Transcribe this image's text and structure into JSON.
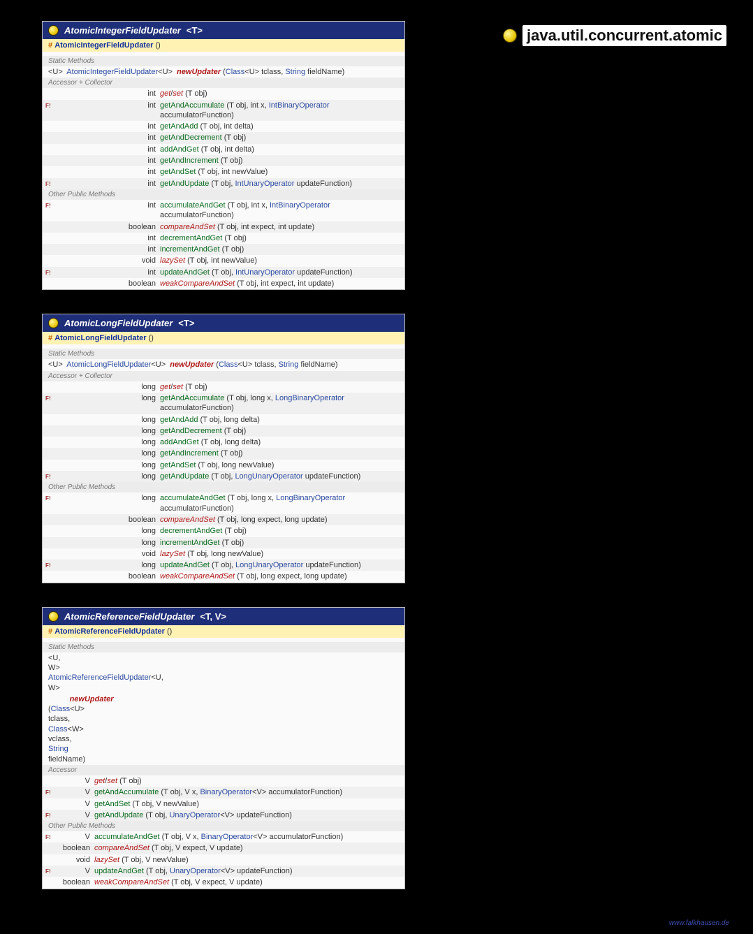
{
  "package_title": "java.util.concurrent.atomic",
  "footer": "www.falkhausen.de",
  "classes": [
    {
      "id": "aifu",
      "name": "AtomicIntegerFieldUpdater",
      "generic": "<T>",
      "constructor": "AtomicIntegerFieldUpdater",
      "static_line_html": "&lt;U&gt;&nbsp; <span class='t-type'>AtomicIntegerFieldUpdater</span>&lt;U&gt;&nbsp; <span class='m-red' style='font-weight:700'>newUpdater</span> (<span class='t-type'>Class</span>&lt;U&gt; tclass, <span class='t-type'>String</span> fieldName)",
      "groups": [
        {
          "header": "Static Methods",
          "static": true
        },
        {
          "header": "Accessor + Collector",
          "rows": [
            {
              "flag": "",
              "ret": "int",
              "sig": "<span class='m-red'>get</span>/<span class='m-red'>set</span> (T obj)"
            },
            {
              "flag": "F !",
              "ret": "int",
              "sig": "<span class='m-green'>getAndAccumulate</span> (T obj, int x, <span class='t-type'>IntBinaryOperator</span> accumulatorFunction)"
            },
            {
              "flag": "",
              "ret": "int",
              "sig": "<span class='m-green'>getAndAdd</span> (T obj, int delta)"
            },
            {
              "flag": "",
              "ret": "int",
              "sig": "<span class='m-green'>getAndDecrement</span> (T obj)"
            },
            {
              "flag": "",
              "ret": "int",
              "sig": "<span class='m-green'>addAndGet</span> (T obj, int delta)"
            },
            {
              "flag": "",
              "ret": "int",
              "sig": "<span class='m-green'>getAndIncrement</span> (T obj)"
            },
            {
              "flag": "",
              "ret": "int",
              "sig": "<span class='m-green'>getAndSet</span> (T obj, int newValue)"
            },
            {
              "flag": "F !",
              "ret": "int",
              "sig": "<span class='m-green'>getAndUpdate</span> (T obj, <span class='t-type'>IntUnaryOperator</span> updateFunction)"
            }
          ]
        },
        {
          "header": "Other Public Methods",
          "rows": [
            {
              "flag": "F !",
              "ret": "int",
              "sig": "<span class='m-green'>accumulateAndGet</span> (T obj, int x, <span class='t-type'>IntBinaryOperator</span> accumulatorFunction)"
            },
            {
              "flag": "",
              "ret": "boolean",
              "sig": "<span class='m-red'>compareAndSet</span> (T obj, int expect, int update)"
            },
            {
              "flag": "",
              "ret": "int",
              "sig": "<span class='m-green'>decrementAndGet</span> (T obj)"
            },
            {
              "flag": "",
              "ret": "int",
              "sig": "<span class='m-green'>incrementAndGet</span> (T obj)"
            },
            {
              "flag": "",
              "ret": "void",
              "sig": "<span class='m-red'>lazySet</span> (T obj, int newValue)"
            },
            {
              "flag": "F !",
              "ret": "int",
              "sig": "<span class='m-green'>updateAndGet</span> (T obj, <span class='t-type'>IntUnaryOperator</span> updateFunction)"
            },
            {
              "flag": "",
              "ret": "boolean",
              "sig": "<span class='m-red'>weakCompareAndSet</span> (T obj, int expect, int update)"
            }
          ]
        }
      ]
    },
    {
      "id": "alfu",
      "name": "AtomicLongFieldUpdater",
      "generic": "<T>",
      "constructor": "AtomicLongFieldUpdater",
      "static_line_html": "&lt;U&gt;&nbsp; <span class='t-type'>AtomicLongFieldUpdater</span>&lt;U&gt;&nbsp; <span class='m-red' style='font-weight:700'>newUpdater</span> (<span class='t-type'>Class</span>&lt;U&gt; tclass, <span class='t-type'>String</span> fieldName)",
      "groups": [
        {
          "header": "Static Methods",
          "static": true
        },
        {
          "header": "Accessor + Collector",
          "rows": [
            {
              "flag": "",
              "ret": "long",
              "sig": "<span class='m-red'>get</span>/<span class='m-red'>set</span> (T obj)"
            },
            {
              "flag": "F !",
              "ret": "long",
              "sig": "<span class='m-green'>getAndAccumulate</span> (T obj, long x, <span class='t-type'>LongBinaryOperator</span> accumulatorFunction)"
            },
            {
              "flag": "",
              "ret": "long",
              "sig": "<span class='m-green'>getAndAdd</span> (T obj, long delta)"
            },
            {
              "flag": "",
              "ret": "long",
              "sig": "<span class='m-green'>getAndDecrement</span> (T obj)"
            },
            {
              "flag": "",
              "ret": "long",
              "sig": "<span class='m-green'>addAndGet</span> (T obj, long delta)"
            },
            {
              "flag": "",
              "ret": "long",
              "sig": "<span class='m-green'>getAndIncrement</span> (T obj)"
            },
            {
              "flag": "",
              "ret": "long",
              "sig": "<span class='m-green'>getAndSet</span> (T obj, long newValue)"
            },
            {
              "flag": "F !",
              "ret": "long",
              "sig": "<span class='m-green'>getAndUpdate</span> (T obj, <span class='t-type'>LongUnaryOperator</span> updateFunction)"
            }
          ]
        },
        {
          "header": "Other Public Methods",
          "rows": [
            {
              "flag": "F !",
              "ret": "long",
              "sig": "<span class='m-green'>accumulateAndGet</span> (T obj, long x, <span class='t-type'>LongBinaryOperator</span> accumulatorFunction)"
            },
            {
              "flag": "",
              "ret": "boolean",
              "sig": "<span class='m-red'>compareAndSet</span> (T obj, long expect, long update)"
            },
            {
              "flag": "",
              "ret": "long",
              "sig": "<span class='m-green'>decrementAndGet</span> (T obj)"
            },
            {
              "flag": "",
              "ret": "long",
              "sig": "<span class='m-green'>incrementAndGet</span> (T obj)"
            },
            {
              "flag": "",
              "ret": "void",
              "sig": "<span class='m-red'>lazySet</span> (T obj, long newValue)"
            },
            {
              "flag": "F !",
              "ret": "long",
              "sig": "<span class='m-green'>updateAndGet</span> (T obj, <span class='t-type'>LongUnaryOperator</span> updateFunction)"
            },
            {
              "flag": "",
              "ret": "boolean",
              "sig": "<span class='m-red'>weakCompareAndSet</span> (T obj, long expect, long update)"
            }
          ]
        }
      ]
    },
    {
      "id": "arfu",
      "narrow": true,
      "name": "AtomicReferenceFieldUpdater",
      "generic": "<T, V>",
      "constructor": "AtomicReferenceFieldUpdater",
      "static_multiline_html": [
        "&lt;U, W&gt;&nbsp; <span class='t-type'>AtomicReferenceFieldUpdater</span>&lt;U, W&gt;",
        "&nbsp;&nbsp;&nbsp;&nbsp;&nbsp;&nbsp;&nbsp;&nbsp;&nbsp;&nbsp;<span class='m-red' style='font-weight:700'>newUpdater</span> (<span class='t-type'>Class</span>&lt;U&gt; tclass, <span class='t-type'>Class</span>&lt;W&gt; vclass, <span class='t-type'>String</span> fieldName)"
      ],
      "groups": [
        {
          "header": "Static Methods",
          "static": true
        },
        {
          "header": "Accessor",
          "rows": [
            {
              "flag": "",
              "ret": "V",
              "sig": "<span class='m-red'>get</span>/<span class='m-red'>set</span> (T obj)"
            },
            {
              "flag": "F !",
              "ret": "V",
              "sig": "<span class='m-green'>getAndAccumulate</span> (T obj, V x, <span class='t-type'>BinaryOperator</span>&lt;V&gt; accumulatorFunction)"
            },
            {
              "flag": "",
              "ret": "V",
              "sig": "<span class='m-green'>getAndSet</span> (T obj, V newValue)"
            },
            {
              "flag": "F !",
              "ret": "V",
              "sig": "<span class='m-green'>getAndUpdate</span> (T obj, <span class='t-type'>UnaryOperator</span>&lt;V&gt; updateFunction)"
            }
          ]
        },
        {
          "header": "Other Public Methods",
          "rows": [
            {
              "flag": "F !",
              "ret": "V",
              "sig": "<span class='m-green'>accumulateAndGet</span> (T obj, V x, <span class='t-type'>BinaryOperator</span>&lt;V&gt; accumulatorFunction)"
            },
            {
              "flag": "",
              "ret": "boolean",
              "sig": "<span class='m-red'>compareAndSet</span> (T obj, V expect, V update)"
            },
            {
              "flag": "",
              "ret": "void",
              "sig": "<span class='m-red'>lazySet</span> (T obj, V newValue)"
            },
            {
              "flag": "F !",
              "ret": "V",
              "sig": "<span class='m-green'>updateAndGet</span> (T obj, <span class='t-type'>UnaryOperator</span>&lt;V&gt; updateFunction)"
            },
            {
              "flag": "",
              "ret": "boolean",
              "sig": "<span class='m-red'>weakCompareAndSet</span> (T obj, V expect, V update)"
            }
          ]
        }
      ]
    }
  ]
}
